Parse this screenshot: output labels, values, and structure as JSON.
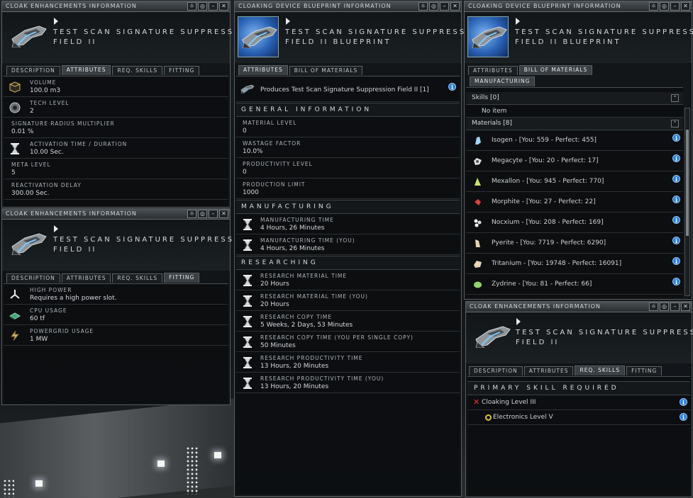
{
  "win1": {
    "title": "CLOAK ENHANCEMENTS INFORMATION",
    "name1": "TEST SCAN SIGNATURE SUPPRESSION",
    "name2": "FIELD II",
    "tabs": [
      "DESCRIPTION",
      "ATTRIBUTES",
      "REQ. SKILLS",
      "FITTING"
    ],
    "rows": [
      {
        "label": "VOLUME",
        "value": "100.0 m3"
      },
      {
        "label": "TECH LEVEL",
        "value": "2"
      },
      {
        "label": "SIGNATURE RADIUS MULTIPLIER",
        "value": "0.01 %"
      },
      {
        "label": "ACTIVATION TIME / DURATION",
        "value": "10.00 Sec."
      },
      {
        "label": "META LEVEL",
        "value": "5"
      },
      {
        "label": "REACTIVATION DELAY",
        "value": "300.00 Sec."
      }
    ]
  },
  "win2": {
    "title": "CLOAK ENHANCEMENTS INFORMATION",
    "name1": "TEST SCAN SIGNATURE SUPPRESSION",
    "name2": "FIELD II",
    "tabs": [
      "DESCRIPTION",
      "ATTRIBUTES",
      "REQ. SKILLS",
      "FITTING"
    ],
    "rows": [
      {
        "label": "HIGH POWER",
        "value": "Requires a high power slot."
      },
      {
        "label": "CPU USAGE",
        "value": "60 tf"
      },
      {
        "label": "POWERGRID USAGE",
        "value": "1 MW"
      }
    ]
  },
  "win3": {
    "title": "CLOAKING DEVICE BLUEPRINT INFORMATION",
    "name1": "TEST SCAN SIGNATURE SUPPRESSION",
    "name2": "FIELD II BLUEPRINT",
    "tabs": [
      "ATTRIBUTES",
      "BILL OF MATERIALS"
    ],
    "produces": "Produces Test Scan Signature Suppression Field II [1]",
    "sec_general": "GENERAL INFORMATION",
    "sec_manu": "MANUFACTURING",
    "sec_research": "RESEARCHING",
    "general": [
      {
        "label": "MATERIAL LEVEL",
        "value": "0"
      },
      {
        "label": "WASTAGE FACTOR",
        "value": "10.0%"
      },
      {
        "label": "PRODUCTIVITY LEVEL",
        "value": "0"
      },
      {
        "label": "PRODUCTION LIMIT",
        "value": "1000"
      }
    ],
    "manu": [
      {
        "label": "MANUFACTURING TIME",
        "value": "4 Hours, 26 Minutes"
      },
      {
        "label": "MANUFACTURING TIME (YOU)",
        "value": "4 Hours, 26 Minutes"
      }
    ],
    "research": [
      {
        "label": "RESEARCH MATERIAL TIME",
        "value": "20 Hours"
      },
      {
        "label": "RESEARCH MATERIAL TIME (YOU)",
        "value": "20 Hours"
      },
      {
        "label": "RESEARCH COPY TIME",
        "value": "5 Weeks, 2 Days, 53 Minutes"
      },
      {
        "label": "RESEARCH COPY TIME (YOU PER SINGLE COPY)",
        "value": "50 Minutes"
      },
      {
        "label": "RESEARCH PRODUCTIVITY TIME",
        "value": "13 Hours, 20 Minutes"
      },
      {
        "label": "RESEARCH PRODUCTIVITY TIME (YOU)",
        "value": "13 Hours, 20 Minutes"
      }
    ]
  },
  "win4": {
    "title": "CLOAKING DEVICE BLUEPRINT INFORMATION",
    "name1": "TEST SCAN SIGNATURE SUPPRESSION",
    "name2": "FIELD II BLUEPRINT",
    "tabs": [
      "ATTRIBUTES",
      "BILL OF MATERIALS"
    ],
    "subtab": "MANUFACTURING",
    "skills_header": "Skills [0]",
    "no_item": "No item",
    "materials_header": "Materials [8]",
    "materials": [
      {
        "text": "Isogen - [You: 559 - Perfect: 455]",
        "color": "#9fd4ff"
      },
      {
        "text": "Megacyte - [You: 20 - Perfect: 17]",
        "color": "#e0e0e0"
      },
      {
        "text": "Mexallon - [You: 945 - Perfect: 770]",
        "color": "#c6e36a"
      },
      {
        "text": "Morphite - [You: 27 - Perfect: 22]",
        "color": "#e0413a"
      },
      {
        "text": "Nocxium - [You: 208 - Perfect: 169]",
        "color": "#f1f1f1"
      },
      {
        "text": "Pyerite - [You: 7719 - Perfect: 6290]",
        "color": "#e8d2ac"
      },
      {
        "text": "Tritanium - [You: 19748 - Perfect: 16091]",
        "color": "#e9d4b8"
      },
      {
        "text": "Zydrine - [You: 81 - Perfect: 66]",
        "color": "#8fd56a"
      }
    ]
  },
  "win5": {
    "title": "CLOAK ENHANCEMENTS INFORMATION",
    "name1": "TEST SCAN SIGNATURE SUPPRESSION",
    "name2": "FIELD II",
    "tabs": [
      "DESCRIPTION",
      "ATTRIBUTES",
      "REQ. SKILLS",
      "FITTING"
    ],
    "section": "PRIMARY SKILL REQUIRED",
    "skills": [
      {
        "text": "Cloaking Level III",
        "status": "missing"
      },
      {
        "text": "Electronics Level V",
        "status": "partial"
      }
    ]
  },
  "colors": {
    "accent": "#2a7fe0",
    "missing": "#e23b2e",
    "partial": "#e1c23a"
  }
}
